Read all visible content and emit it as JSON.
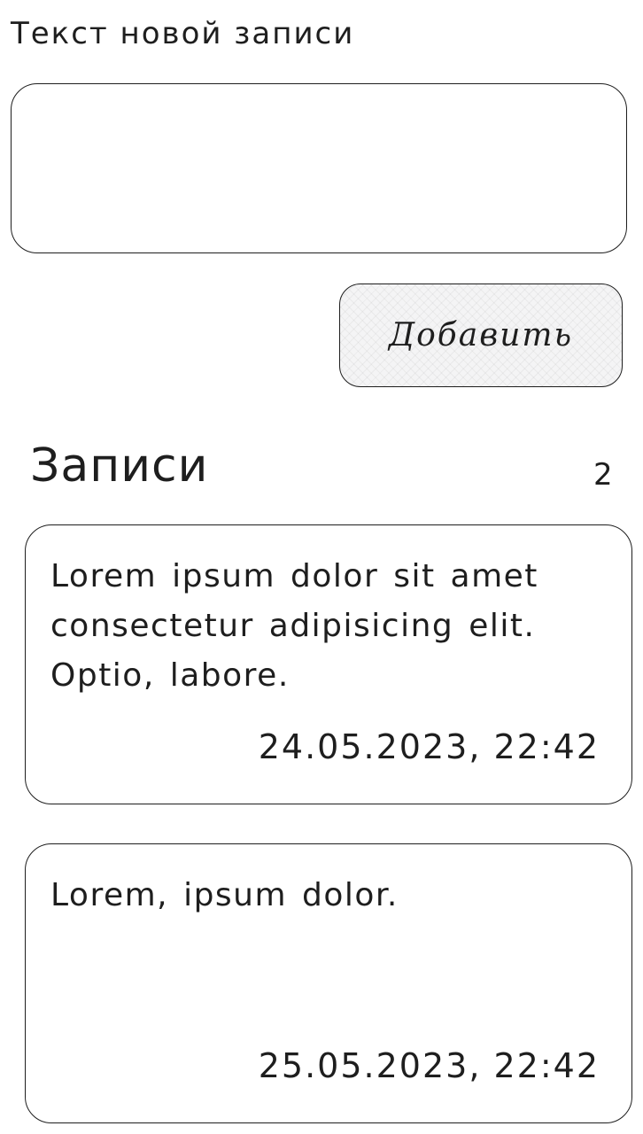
{
  "form": {
    "label": "Текст новой записи",
    "input_value": "",
    "add_button_label": "Добавить"
  },
  "notes_section": {
    "title": "Записи",
    "count": "2",
    "items": [
      {
        "text": "Lorem ipsum dolor sit amet consectetur adipisicing elit. Optio, labore.",
        "date": "24.05.2023, 22:42"
      },
      {
        "text": "Lorem, ipsum dolor.",
        "date": "25.05.2023, 22:42"
      }
    ]
  }
}
